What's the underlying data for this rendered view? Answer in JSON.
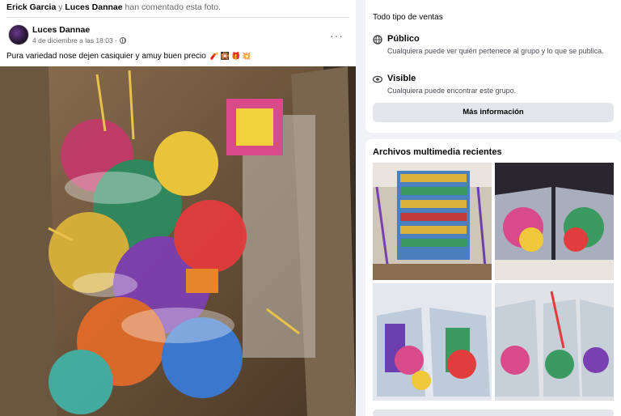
{
  "post": {
    "activity": {
      "user1": "Erick Garcia",
      "conj": "y",
      "user2": "Luces Dannae",
      "suffix": "han comentado esta foto."
    },
    "author": "Luces Dannae",
    "date": "4 de diciembre a las 18:03 ·",
    "caption": "Pura variedad nose dejen casiquier y amuy buen precio",
    "emoji_names": [
      "firecracker-icon",
      "sparkler-icon",
      "gift-icon",
      "explosion-icon"
    ],
    "more": "···"
  },
  "sidebar": {
    "sales_type": "Todo tipo de ventas",
    "public": {
      "title": "Público",
      "desc": "Cualquiera puede ver quién pertenece al grupo y lo que se publica."
    },
    "visible": {
      "title": "Visible",
      "desc": "Cualquiera puede encontrar este grupo."
    },
    "more_info": "Más información",
    "media_title": "Archivos multimedia recientes"
  },
  "colors": {
    "background": "#f0f2f5",
    "card": "#ffffff",
    "secondary_text": "#65676b",
    "button_bg": "#e4e6eb"
  }
}
